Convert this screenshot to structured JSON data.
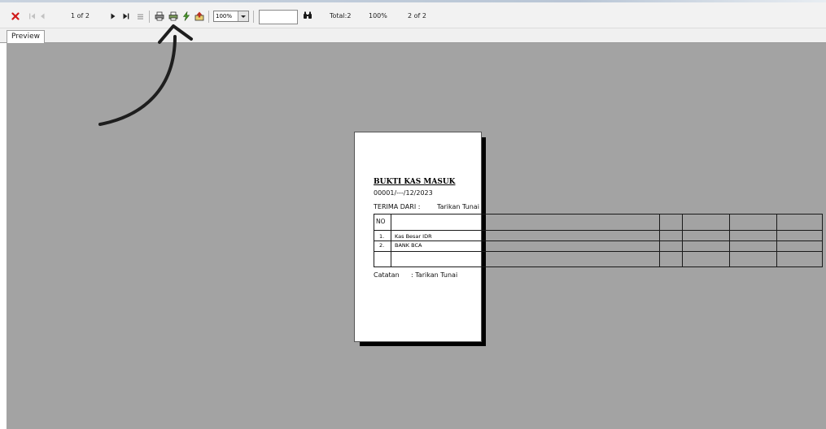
{
  "toolbar": {
    "page_indicator": "1 of 2",
    "zoom_value": "100%",
    "search_value": "",
    "total_label": "Total:2",
    "zoom_percent": "100%",
    "page_status": "2 of 2"
  },
  "tabs": [
    {
      "label": "Preview"
    }
  ],
  "document": {
    "title": "BUKTI KAS MASUK",
    "number": "00001/---/12/2023",
    "terima_dari_label": "TERIMA DARI :",
    "terima_dari_value": "Tarikan Tunai",
    "table_header_no": "NO",
    "rows": [
      {
        "no": "1.",
        "desc": "Kas Besar IDR"
      },
      {
        "no": "2.",
        "desc": "BANK BCA"
      }
    ],
    "catatan_label": "Catatan",
    "catatan_value": ": Tarikan Tunai"
  },
  "colors": {
    "canvas": "#a3a3a3",
    "close_icon": "#d11a1a",
    "arrow_annotation": "#1e1e1e"
  }
}
